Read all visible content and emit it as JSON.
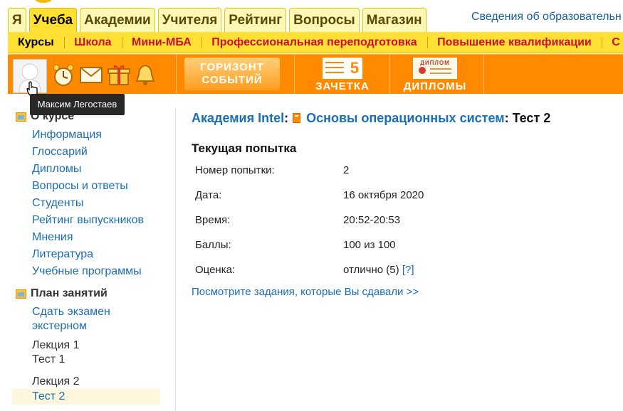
{
  "top_tabs": [
    "Я",
    "Учеба",
    "Академии",
    "Учителя",
    "Рейтинг",
    "Вопросы",
    "Магазин"
  ],
  "active_tab": "Учеба",
  "top_link": "Сведения об образовательн",
  "subnav": [
    "Курсы",
    "Школа",
    "Мини-МБА",
    "Профессиональная переподготовка",
    "Повышение квалификации",
    "С"
  ],
  "banners": {
    "horizon_line1": "ГОРИЗОНТ",
    "horizon_line2": "СОБЫТИЙ",
    "gradebook_number": "5",
    "gradebook": "ЗАЧЕТКА",
    "diploma_small": "ДИПЛОМ",
    "diplomas": "ДИПЛОМЫ"
  },
  "tooltip": "Максим Легостаев",
  "sidebar": {
    "about_title": "О курсе",
    "about_links": [
      "Информация",
      "Глоссарий",
      "Дипломы",
      "Вопросы и ответы",
      "Студенты",
      "Рейтинг выпускников",
      "Мнения",
      "Литература",
      "Учебные программы"
    ],
    "plan_title": "План занятий",
    "plan_link": "Сдать экзамен экстерном",
    "lecture1": "Лекция 1",
    "test1": "Тест 1",
    "lecture2": "Лекция 2",
    "test2": "Тест 2"
  },
  "breadcrumb": {
    "academy": "Академия Intel",
    "course": "Основы операционных систем",
    "current": "Тест 2"
  },
  "attempt": {
    "heading": "Текущая попытка",
    "rows": [
      {
        "label": "Номер попытки:",
        "value": "2"
      },
      {
        "label": "Дата:",
        "value": "16 октября 2020"
      },
      {
        "label": "Время:",
        "value": "20:52-20:53"
      },
      {
        "label": "Баллы:",
        "value": "100 из 100"
      },
      {
        "label": "Оценка:",
        "value": "отлично (5)"
      }
    ],
    "help": "[?]"
  },
  "view_link": "Посмотрите задания, которые Вы сдавали >>",
  "colors": {
    "accent_orange": "#ff8a00",
    "tab_yellow": "#ffe033",
    "link_blue": "#1a6eb5",
    "subnav_red": "#c8102e"
  }
}
